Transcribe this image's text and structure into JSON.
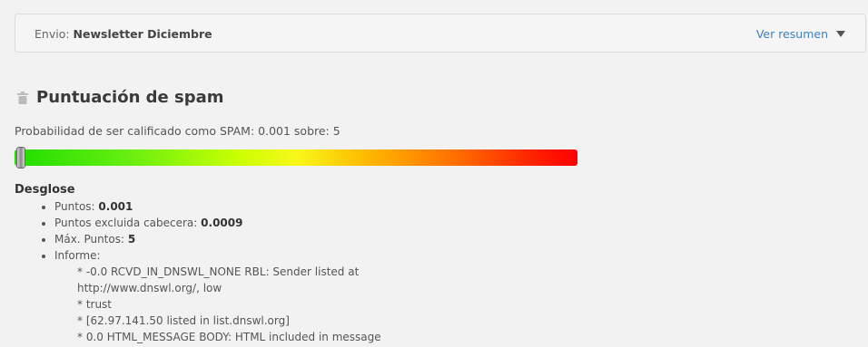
{
  "envio": {
    "label": "Envio:",
    "name": "Newsletter Diciembre",
    "toggle_label": "Ver resumen"
  },
  "spam": {
    "title": "Puntuación de spam",
    "probability_text": "Probabilidad de ser calificado como SPAM: 0.001 sobre: 5",
    "score": 0.001,
    "max": 5
  },
  "breakdown": {
    "heading": "Desglose",
    "items": [
      {
        "label": "Puntos:",
        "value": "0.001"
      },
      {
        "label": "Puntos excluida cabecera:",
        "value": "0.0009"
      },
      {
        "label": "Máx. Puntos:",
        "value": "5"
      },
      {
        "label": "Informe:",
        "value": ""
      }
    ],
    "report_lines": [
      "* -0.0 RCVD_IN_DNSWL_NONE RBL: Sender listed at",
      "http://www.dnswl.org/, low",
      "* trust",
      "* [62.97.141.50 listed in list.dnswl.org]",
      "* 0.0 HTML_MESSAGE BODY: HTML included in message"
    ]
  },
  "colors": {
    "accent_link": "#3f7fbf",
    "meter_low": "#22dd00",
    "meter_mid": "#f8f818",
    "meter_high": "#ff0000"
  },
  "icons": {
    "heading_icon": "trash-icon",
    "toggle_icon": "caret-down-icon"
  }
}
